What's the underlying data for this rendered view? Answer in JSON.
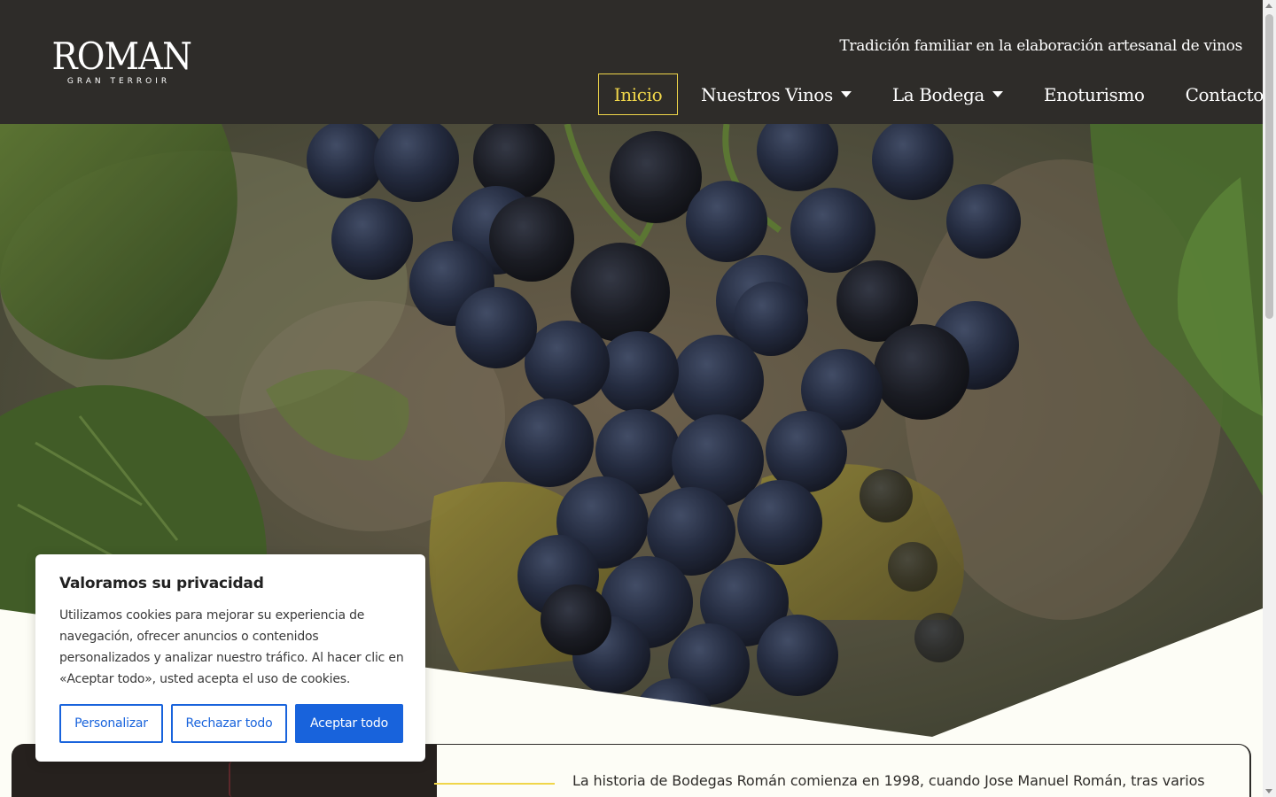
{
  "header": {
    "logo_main": "ROMAN",
    "logo_sub": "GRAN TERROIR",
    "tagline": "Tradición familiar en la elaboración artesanal de vinos"
  },
  "nav": {
    "items": [
      {
        "label": "Inicio",
        "active": true
      },
      {
        "label": "Nuestros Vinos",
        "dropdown": true
      },
      {
        "label": "La Bodega",
        "dropdown": true
      },
      {
        "label": "Enoturismo"
      },
      {
        "label": "Contacto"
      }
    ]
  },
  "hero": {
    "image": "grape-cluster-photo"
  },
  "content": {
    "history_text": "La historia de Bodegas Román comienza en 1998, cuando Jose Manuel Román, tras varios"
  },
  "cookie_banner": {
    "title": "Valoramos su privacidad",
    "text": "Utilizamos cookies para mejorar su experiencia de navegación, ofrecer anuncios o contenidos personalizados y analizar nuestro tráfico. Al hacer clic en «Aceptar todo», usted acepta el uso de cookies.",
    "buttons": {
      "customize": "Personalizar",
      "reject": "Rechazar todo",
      "accept": "Aceptar todo"
    }
  },
  "colors": {
    "header_bg": "#2e2c29",
    "active_nav": "#f0d64a",
    "cookie_accent": "#1863dc",
    "page_bg": "#fdfdf6"
  }
}
